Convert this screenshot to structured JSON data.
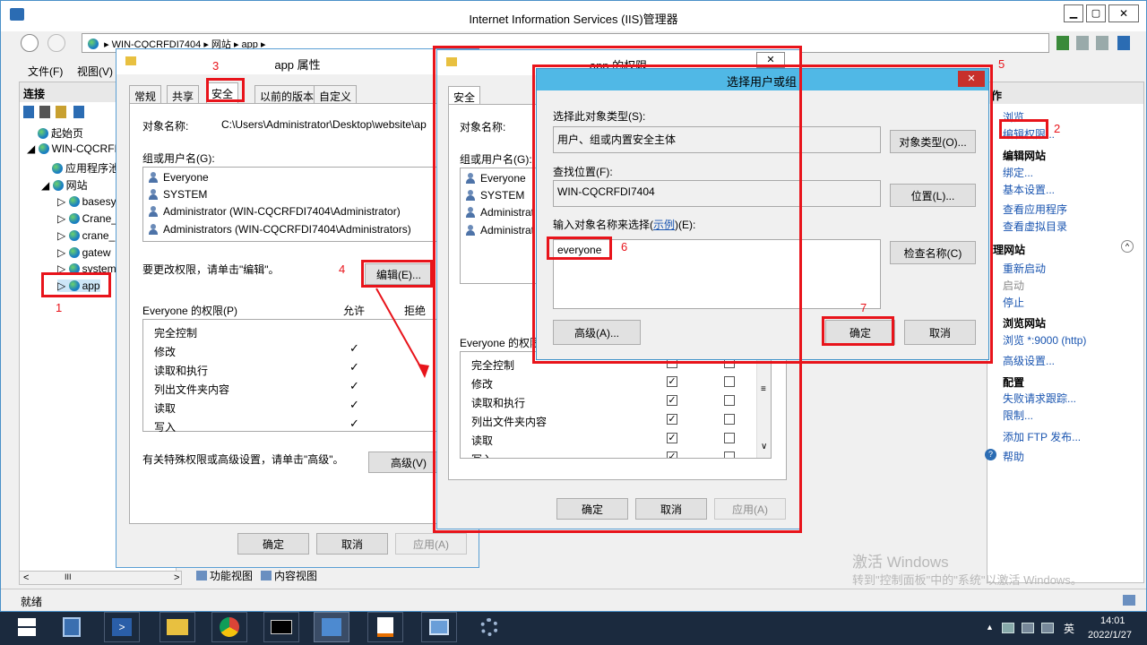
{
  "window": {
    "title": "Internet Information Services (IIS)管理器",
    "min": "▁",
    "max": "▢",
    "close": "✕"
  },
  "address": {
    "host": "WIN-CQCRFDI7404",
    "site": "网站",
    "app": "app"
  },
  "menu": {
    "file": "文件(F)",
    "view": "视图(V)"
  },
  "left_panel": {
    "title": "连接",
    "tree": [
      "起始页",
      "WIN-CQCRFI",
      "应用程序池",
      "网站",
      "basesy",
      "Crane_",
      "crane_",
      "gatew",
      "system",
      "app"
    ]
  },
  "status": {
    "text": "就绪",
    "feature_view": "功能视图",
    "content_view": "内容视图",
    "scroll_left": "<",
    "scroll_thumb": "III",
    "scroll_right": ">"
  },
  "actions": {
    "title": "作",
    "browse": "浏览",
    "edit_perm": "编辑权限...",
    "edit_site": "编辑网站",
    "bind": "绑定...",
    "basic": "基本设置...",
    "view_apps": "查看应用程序",
    "view_vdirs": "查看虚拟目录",
    "manage": "理网站",
    "restart": "重新启动",
    "start": "启动",
    "stop": "停止",
    "browse_site": "浏览网站",
    "browse_9000": "浏览 *:9000 (http)",
    "advanced": "高级设置...",
    "config": "配置",
    "failed": "失败请求跟踪...",
    "limit": "限制...",
    "ftp": "添加 FTP 发布...",
    "help": "帮助"
  },
  "props": {
    "title": "app 属性",
    "tabs": [
      "常规",
      "共享",
      "安全",
      "以前的版本",
      "自定义"
    ],
    "object_label": "对象名称:",
    "object_value": "C:\\Users\\Administrator\\Desktop\\website\\ap",
    "group_label": "组或用户名(G):",
    "users": [
      "Everyone",
      "SYSTEM",
      "Administrator (WIN-CQCRFDI7404\\Administrator)",
      "Administrators (WIN-CQCRFDI7404\\Administrators)"
    ],
    "change_hint": "要更改权限，请单击\"编辑\"。",
    "edit_btn": "编辑(E)...",
    "perm_label": "Everyone 的权限(P)",
    "allow": "允许",
    "deny": "拒绝",
    "perms": [
      "完全控制",
      "修改",
      "读取和执行",
      "列出文件夹内容",
      "读取",
      "写入"
    ],
    "checkmark": "✓",
    "special_hint": "有关特殊权限或高级设置，请单击\"高级\"。",
    "advanced_btn": "高级(V)",
    "ok": "确定",
    "cancel": "取消",
    "apply": "应用(A)"
  },
  "perm_dialog": {
    "title": "app 的权限",
    "close": "✕",
    "tab": "安全",
    "object_label": "对象名称:",
    "group_label": "组或用户名(G):",
    "users": [
      "Everyone",
      "SYSTEM",
      "Administrat",
      "Administrat"
    ],
    "perm_label": "Everyone 的权限",
    "perms": [
      "完全控制",
      "修改",
      "读取和执行",
      "列出文件夹内容",
      "读取",
      "写入"
    ],
    "check": "✓",
    "scroll_grip": "≡",
    "scroll_down": "∨",
    "ok": "确定",
    "cancel": "取消",
    "apply": "应用(A)"
  },
  "select_dialog": {
    "title": "选择用户或组",
    "close": "✕",
    "type_label": "选择此对象类型(S):",
    "type_value": "用户、组或内置安全主体",
    "type_btn": "对象类型(O)...",
    "loc_label": "查找位置(F):",
    "loc_value": "WIN-CQCRFDI7404",
    "loc_btn": "位置(L)...",
    "name_label_pre": "输入对象名称来选择(",
    "name_label_link": "示例",
    "name_label_post": ")(E):",
    "name_value": "everyone",
    "check_btn": "检查名称(C)",
    "advanced_btn": "高级(A)...",
    "ok": "确定",
    "cancel": "取消"
  },
  "annotations": [
    "1",
    "2",
    "3",
    "4",
    "5",
    "6",
    "7"
  ],
  "watermark": {
    "line1": "激活 Windows",
    "line2": "转到\"控制面板\"中的\"系统\"以激活 Windows。"
  },
  "taskbar": {
    "time": "14:01",
    "date": "2022/1/27",
    "ime": "英"
  },
  "colors": {
    "accent": "#1683c6",
    "annotation": "#e8141b",
    "dialog_title": "#50b8e6"
  }
}
